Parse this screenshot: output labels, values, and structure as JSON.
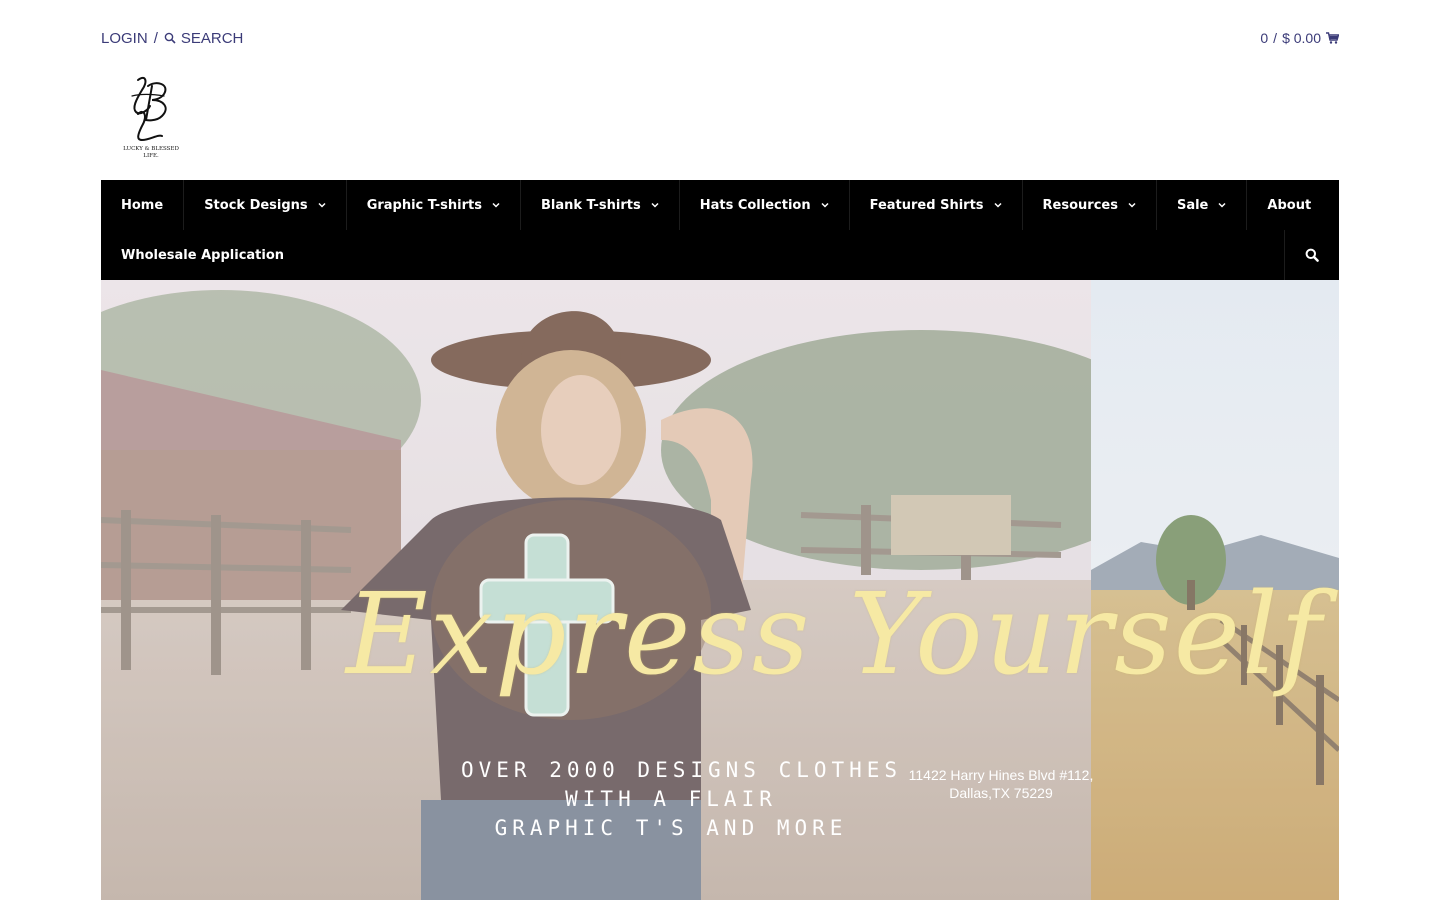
{
  "topbar": {
    "login_label": "LOGIN",
    "separator": "/",
    "search_label": "SEARCH",
    "cart_count": "0",
    "cart_separator": "/",
    "cart_total": "$ 0.00"
  },
  "logo": {
    "monogram": "LBL",
    "tagline": "LUCKY & BLESSED LIFE."
  },
  "nav": {
    "items": [
      {
        "label": "Home",
        "has_dropdown": false
      },
      {
        "label": "Stock Designs",
        "has_dropdown": true
      },
      {
        "label": "Graphic T-shirts",
        "has_dropdown": true
      },
      {
        "label": "Blank T-shirts",
        "has_dropdown": true
      },
      {
        "label": "Hats Collection",
        "has_dropdown": true
      },
      {
        "label": "Featured Shirts",
        "has_dropdown": true
      },
      {
        "label": "Resources",
        "has_dropdown": true
      },
      {
        "label": "Sale",
        "has_dropdown": true
      },
      {
        "label": "About",
        "has_dropdown": false
      },
      {
        "label": "Wholesale Application",
        "has_dropdown": false
      }
    ],
    "search_icon": "search-icon"
  },
  "hero": {
    "title": "Express Yourself",
    "lines": [
      "OVER  2000 DESIGNS CLOTHES",
      "WITH A FLAIR",
      "GRAPHIC T'S AND MORE"
    ],
    "address_line1": "11422 Harry Hines Blvd #112,",
    "address_line2": "Dallas,TX 75229"
  },
  "colors": {
    "nav_bg": "#000000",
    "topbar_text": "#3b3b78",
    "hero_title": "#f6e9a4"
  }
}
